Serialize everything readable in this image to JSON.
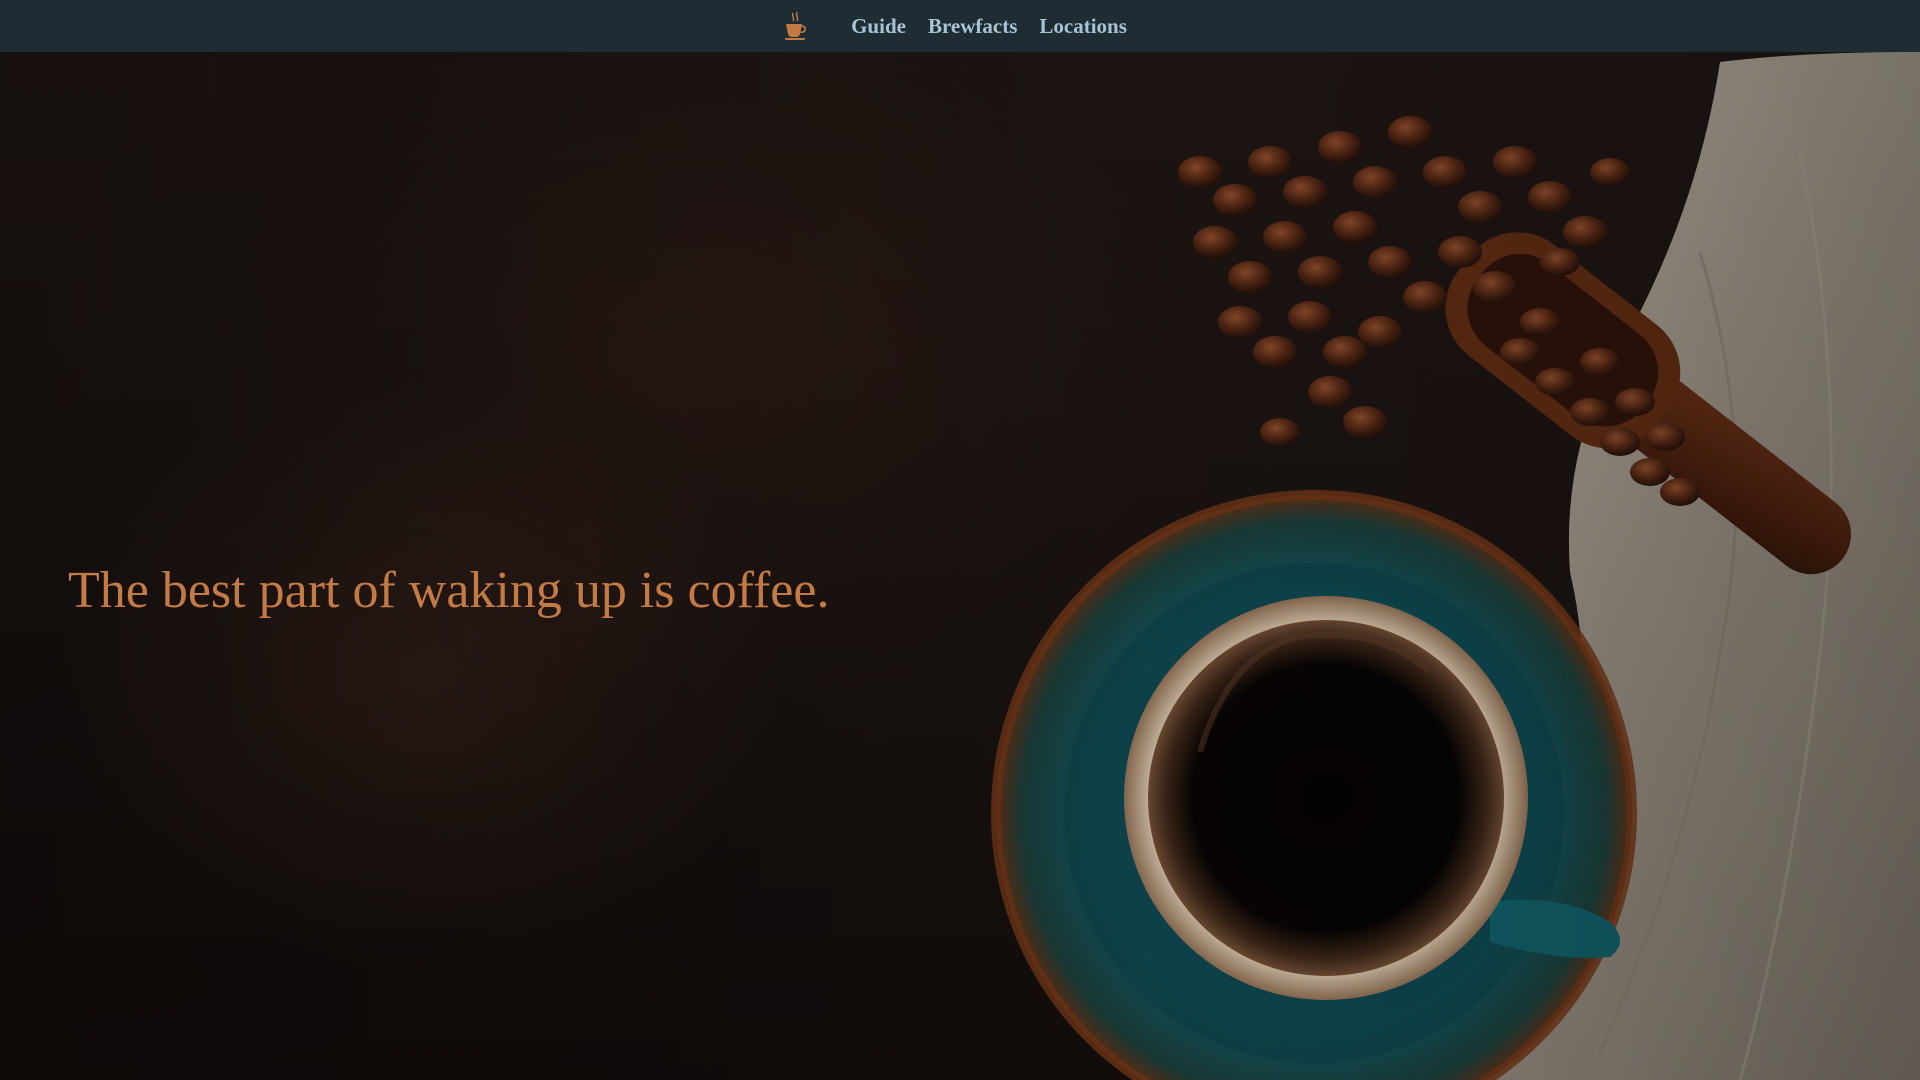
{
  "nav": {
    "logo_icon": "coffee-cup-icon",
    "links": [
      {
        "label": "Guide"
      },
      {
        "label": "Brewfacts"
      },
      {
        "label": "Locations"
      }
    ]
  },
  "hero": {
    "tagline": "The best part of waking up is coffee.",
    "background_image": "coffee-cup-saucer-beans-scoop-photo"
  },
  "colors": {
    "navbar_bg": "#1e2d34",
    "nav_link": "#a9c3d4",
    "tagline": "#c47a45",
    "accent": "#c47a45"
  }
}
